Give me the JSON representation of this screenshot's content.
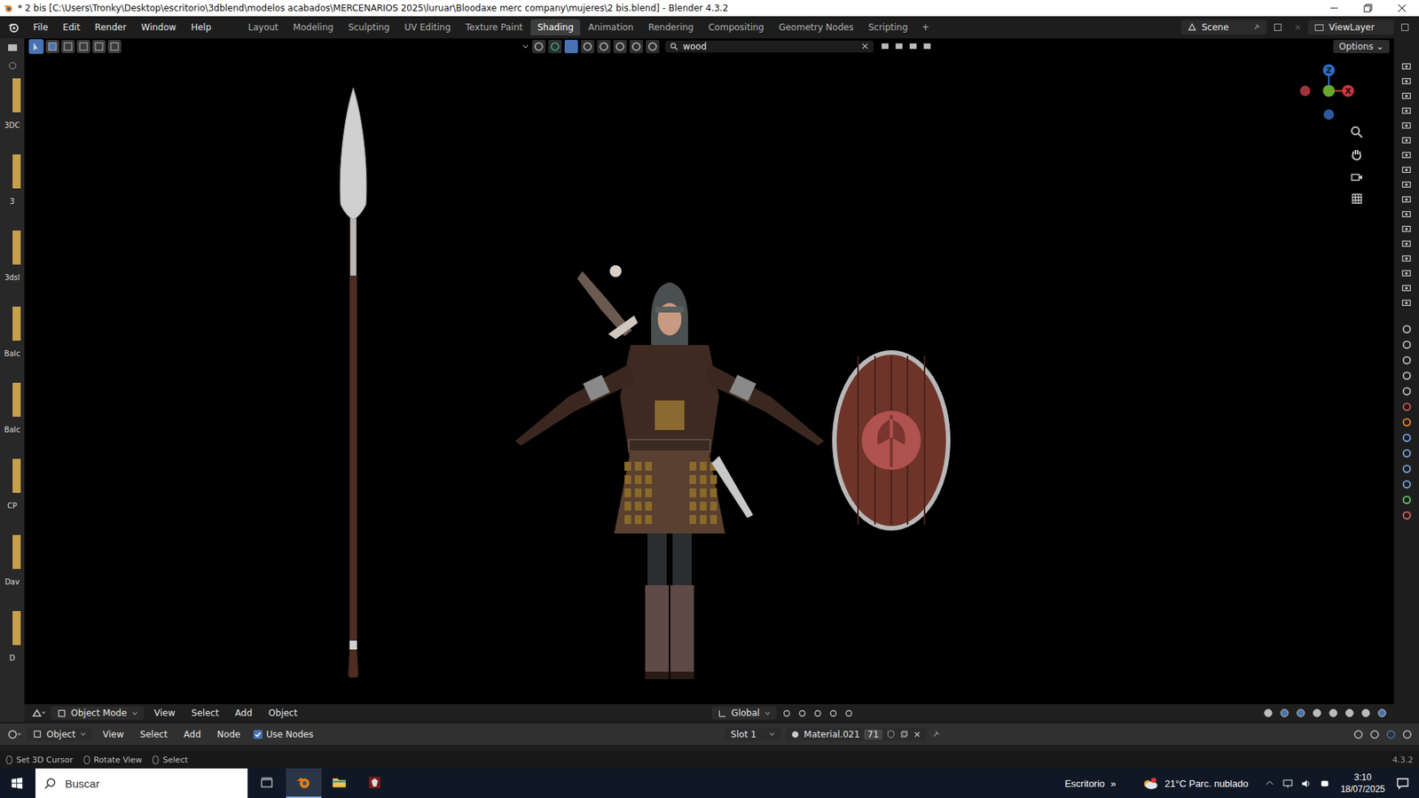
{
  "window": {
    "title": "* 2 bis [C:\\Users\\Tronky\\Desktop\\escritorio\\3dblend\\modelos acabados\\MERCENARIOS 2025\\luruar\\Bloodaxe merc company\\mujeres\\2 bis.blend] - Blender 4.3.2"
  },
  "menu": [
    "File",
    "Edit",
    "Render",
    "Window",
    "Help"
  ],
  "workspaces": [
    {
      "label": "Layout",
      "selected": false
    },
    {
      "label": "Modeling",
      "selected": false
    },
    {
      "label": "Sculpting",
      "selected": false
    },
    {
      "label": "UV Editing",
      "selected": false
    },
    {
      "label": "Texture Paint",
      "selected": false
    },
    {
      "label": "Shading",
      "selected": true
    },
    {
      "label": "Animation",
      "selected": false
    },
    {
      "label": "Rendering",
      "selected": false
    },
    {
      "label": "Compositing",
      "selected": false
    },
    {
      "label": "Geometry Nodes",
      "selected": false
    },
    {
      "label": "Scripting",
      "selected": false
    }
  ],
  "add_workspace": "+",
  "scene": "Scene",
  "view_layer": "ViewLayer",
  "asset_browser": {
    "items": [
      "3DC",
      "3",
      "3dsl",
      "Balc",
      "Balc",
      "CP",
      "Dav",
      "D"
    ]
  },
  "viewport": {
    "search": "wood",
    "options": "Options",
    "gizmo": {
      "z": "Z",
      "x": "X"
    },
    "header": {
      "mode": "Object Mode",
      "menus": [
        "View",
        "Select",
        "Add",
        "Object"
      ],
      "orientation": "Global"
    }
  },
  "shader_editor": {
    "mode": "Object",
    "menus": [
      "View",
      "Select",
      "Add",
      "Node"
    ],
    "use_nodes": {
      "label": "Use Nodes",
      "checked": true
    },
    "slot": "Slot 1",
    "material": "Material.021",
    "users": "71"
  },
  "status_bar": {
    "hints": [
      "Set 3D Cursor",
      "Rotate View",
      "Select"
    ],
    "version": "4.3.2"
  },
  "taskbar": {
    "search": "Buscar",
    "desktop": "Escritorio",
    "overflow": "»",
    "weather": "21°C Parc. nublado",
    "time": "3:10",
    "date": "18/07/2025",
    "apps": [
      {
        "kind": "blender",
        "selected": true
      },
      {
        "kind": "explorer",
        "selected": false
      },
      {
        "kind": "game",
        "selected": false
      }
    ]
  }
}
